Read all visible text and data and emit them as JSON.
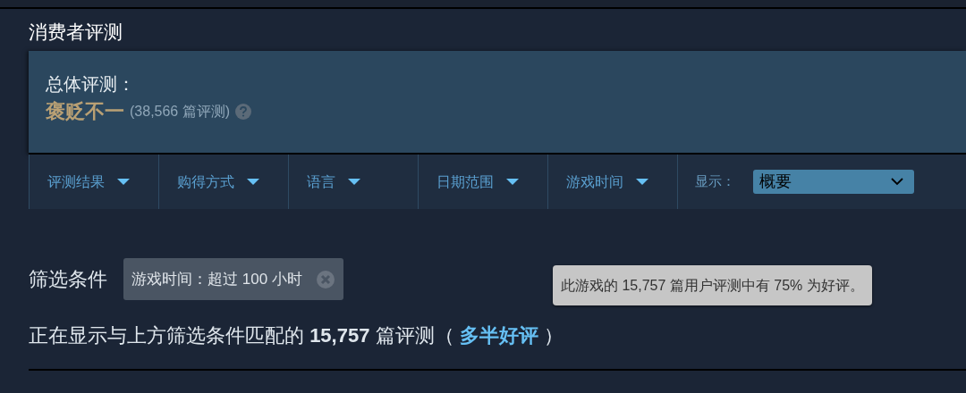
{
  "section_title": "消费者评测",
  "summary": {
    "label": "总体评测：",
    "rating": "褒贬不一",
    "count": "(38,566 篇评测)"
  },
  "filters": [
    {
      "label": "评测结果"
    },
    {
      "label": "购得方式"
    },
    {
      "label": "语言"
    },
    {
      "label": "日期范围"
    },
    {
      "label": "游戏时间"
    }
  ],
  "display": {
    "label": "显示：",
    "value": "概要"
  },
  "active_filters": {
    "label": "筛选条件",
    "chips": [
      {
        "text": "游戏时间：超过 100 小时"
      }
    ]
  },
  "tooltip": "此游戏的 15,757 篇用户评测中有 75% 为好评。",
  "match": {
    "before": "正在显示与上方筛选条件匹配的 **15,757** 篇评测（ ",
    "link": "多半好评",
    "after": " ）"
  }
}
